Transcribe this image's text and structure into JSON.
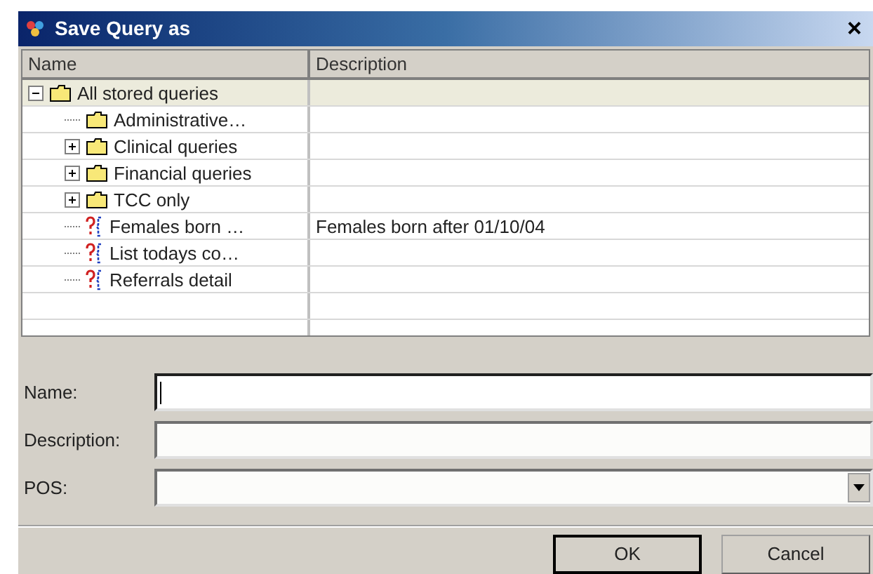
{
  "window": {
    "title": "Save Query as",
    "close": "×"
  },
  "table": {
    "columns": [
      "Name",
      "Description"
    ],
    "rows": [
      {
        "name": "All stored queries",
        "kind": "folder",
        "selected": true,
        "expanded": true,
        "children": [
          {
            "name": "Administrative…",
            "kind": "folder",
            "selected": false
          },
          {
            "name": "Clinical queries",
            "kind": "folder",
            "selected": false,
            "expanded": false
          },
          {
            "name": "Financial queries",
            "kind": "folder",
            "selected": false,
            "expanded": false
          },
          {
            "name": "TCC only",
            "kind": "folder",
            "selected": false,
            "expanded": false
          },
          {
            "name": "Females born …",
            "description": "Females born after 01/10/04",
            "kind": "query",
            "selected": false
          },
          {
            "name": "List todays co…",
            "kind": "query",
            "selected": false
          },
          {
            "name": "Referrals detail",
            "kind": "query",
            "selected": false
          }
        ]
      }
    ]
  },
  "form": [
    {
      "label": "Name:",
      "kind": "text",
      "focused": true
    },
    {
      "label": "Description:",
      "kind": "text",
      "focused": false
    },
    {
      "label": "POS:",
      "kind": "dropdown",
      "focused": false
    }
  ],
  "buttons": [
    {
      "label": "OK",
      "default": true
    },
    {
      "label": "Cancel",
      "default": false
    }
  ]
}
